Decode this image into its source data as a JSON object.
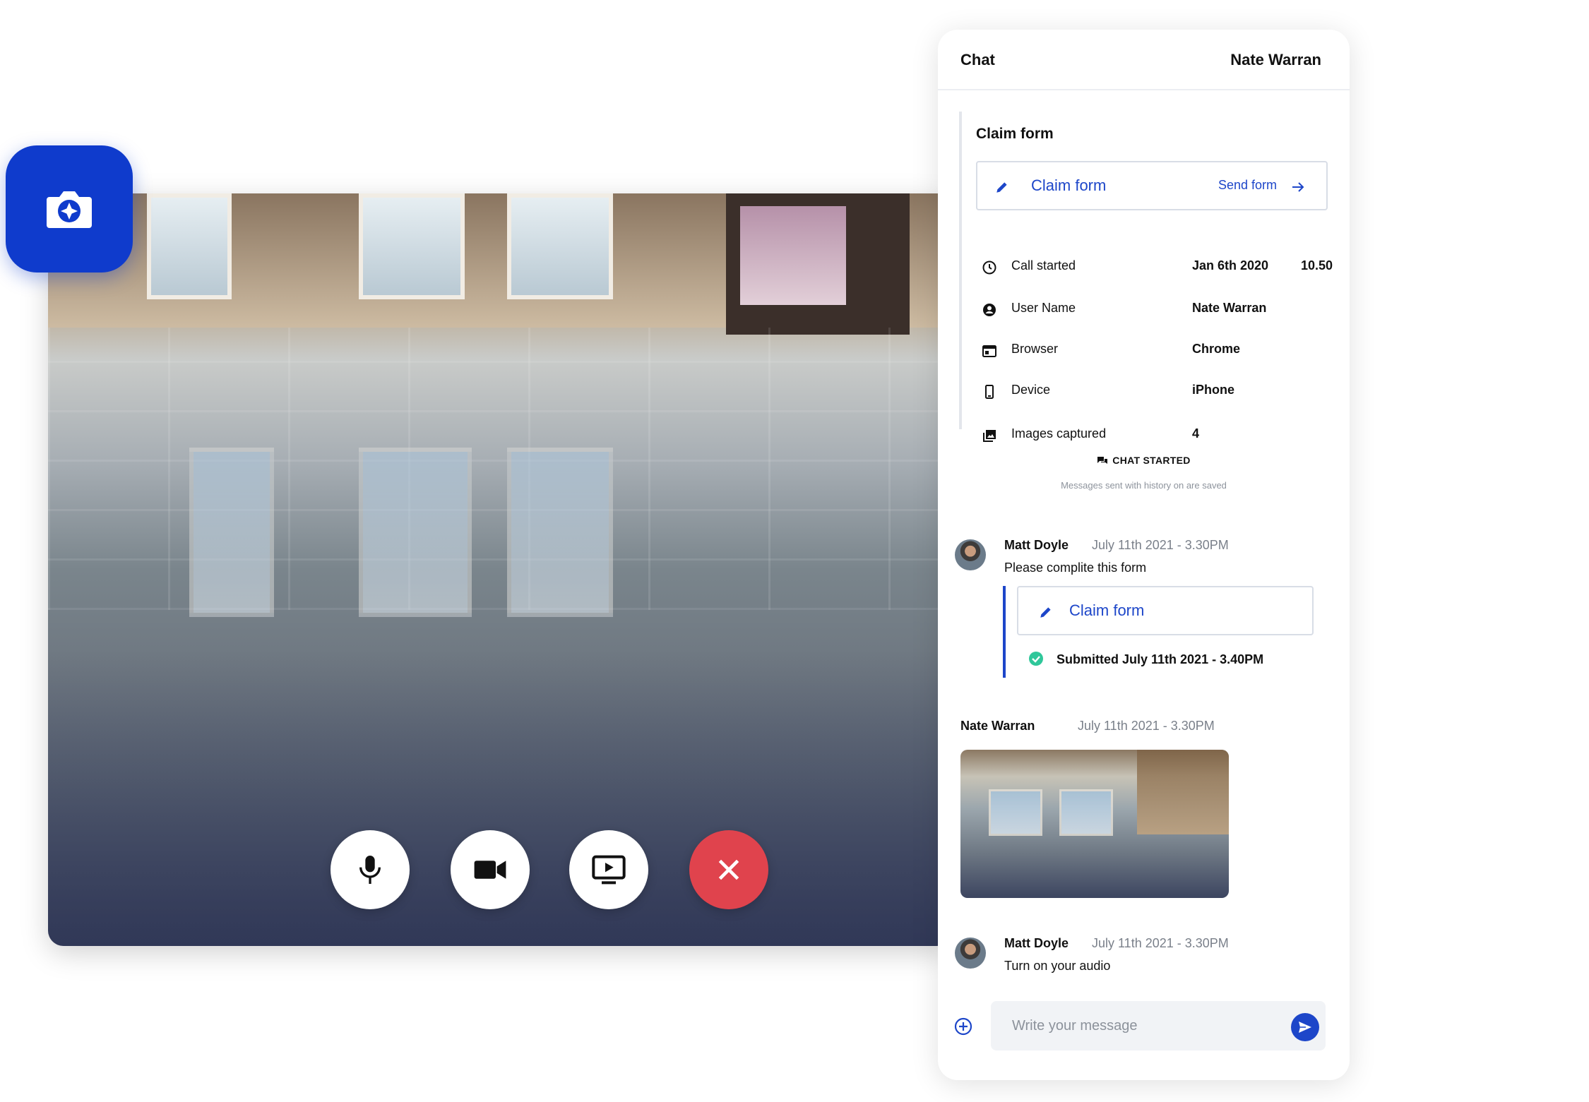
{
  "header": {
    "title": "Chat",
    "user": "Nate Warran"
  },
  "claim_section": {
    "heading": "Claim form",
    "button_label": "Claim form",
    "send_label": "Send form"
  },
  "info": [
    {
      "icon": "clock-icon",
      "label": "Call started",
      "value": "Jan 6th 2020",
      "value2": "10.50"
    },
    {
      "icon": "user-circle-icon",
      "label": "User Name",
      "value": "Nate Warran"
    },
    {
      "icon": "browser-icon",
      "label": "Browser",
      "value": "Chrome"
    },
    {
      "icon": "phone-icon",
      "label": "Device",
      "value": "iPhone"
    },
    {
      "icon": "images-icon",
      "label": "Images captured",
      "value": "4"
    }
  ],
  "chat_started": {
    "label": "CHAT STARTED",
    "note": "Messages sent with history on are saved"
  },
  "messages": [
    {
      "author": "Matt Doyle",
      "time": "July 11th 2021 - 3.30PM",
      "text": "Please complite this form",
      "form_label": "Claim form",
      "submitted": "Submitted July 11th 2021 - 3.40PM"
    },
    {
      "author": "Nate Warran",
      "time": "July 11th 2021 - 3.30PM"
    },
    {
      "author": "Matt Doyle",
      "time": "July 11th 2021 - 3.30PM",
      "text": "Turn on your audio"
    }
  ],
  "composer": {
    "placeholder": "Write your message"
  },
  "video_controls": {
    "icons": [
      "microphone-icon",
      "video-camera-icon",
      "screen-share-icon",
      "close-icon"
    ]
  },
  "colors": {
    "accent": "#1d46c9",
    "badge": "#0f3bcc",
    "end_call": "#e0434d",
    "success": "#2fc79a"
  }
}
